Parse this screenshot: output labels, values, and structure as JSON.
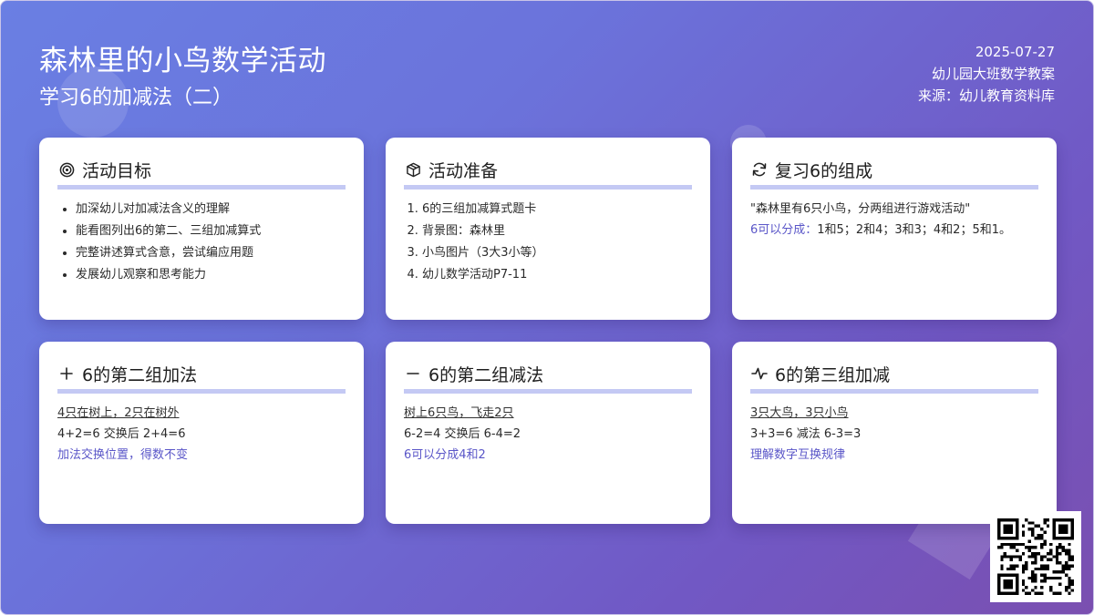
{
  "header": {
    "title": "森林里的小鸟数学活动",
    "subtitle": "学习6的加减法（二）",
    "date": "2025-07-27",
    "category": "幼儿园大班数学教案",
    "source": "来源：幼儿教育资料库"
  },
  "cards": {
    "goals": {
      "icon": "target-icon",
      "title": "活动目标",
      "items": [
        "加深幼儿对加减法含义的理解",
        "能看图列出6的第二、三组加减算式",
        "完整讲述算式含意，尝试编应用题",
        "发展幼儿观察和思考能力"
      ]
    },
    "prep": {
      "icon": "box-icon",
      "title": "活动准备",
      "items": [
        "6的三组加减算式题卡",
        "背景图：森林里",
        "小鸟图片（3大3小等）",
        "幼儿数学活动P7-11"
      ]
    },
    "review": {
      "icon": "refresh-icon",
      "title": "复习6的组成",
      "quote": "\"森林里有6只小鸟，分两组进行游戏活动\"",
      "lead": "6可以分成：",
      "rest": "1和5；2和4；3和3；4和2；5和1。"
    },
    "add": {
      "icon": "plus-icon",
      "title": "6的第二组加法",
      "scene": "4只在树上，2只在树外",
      "formula": "4+2=6 交换后 2+4=6",
      "note": "加法交换位置，得数不变"
    },
    "sub": {
      "icon": "minus-icon",
      "title": "6的第二组减法",
      "scene": "树上6只鸟，飞走2只",
      "formula": "6-2=4 交换后 6-4=2",
      "note": "6可以分成4和2"
    },
    "mix": {
      "icon": "pulse-icon",
      "title": "6的第三组加减",
      "scene": "3只大鸟，3只小鸟",
      "formula": "3+3=6 减法 6-3=3",
      "note": "理解数字互换规律"
    }
  },
  "qr": {
    "icon": "qr-code-icon"
  }
}
